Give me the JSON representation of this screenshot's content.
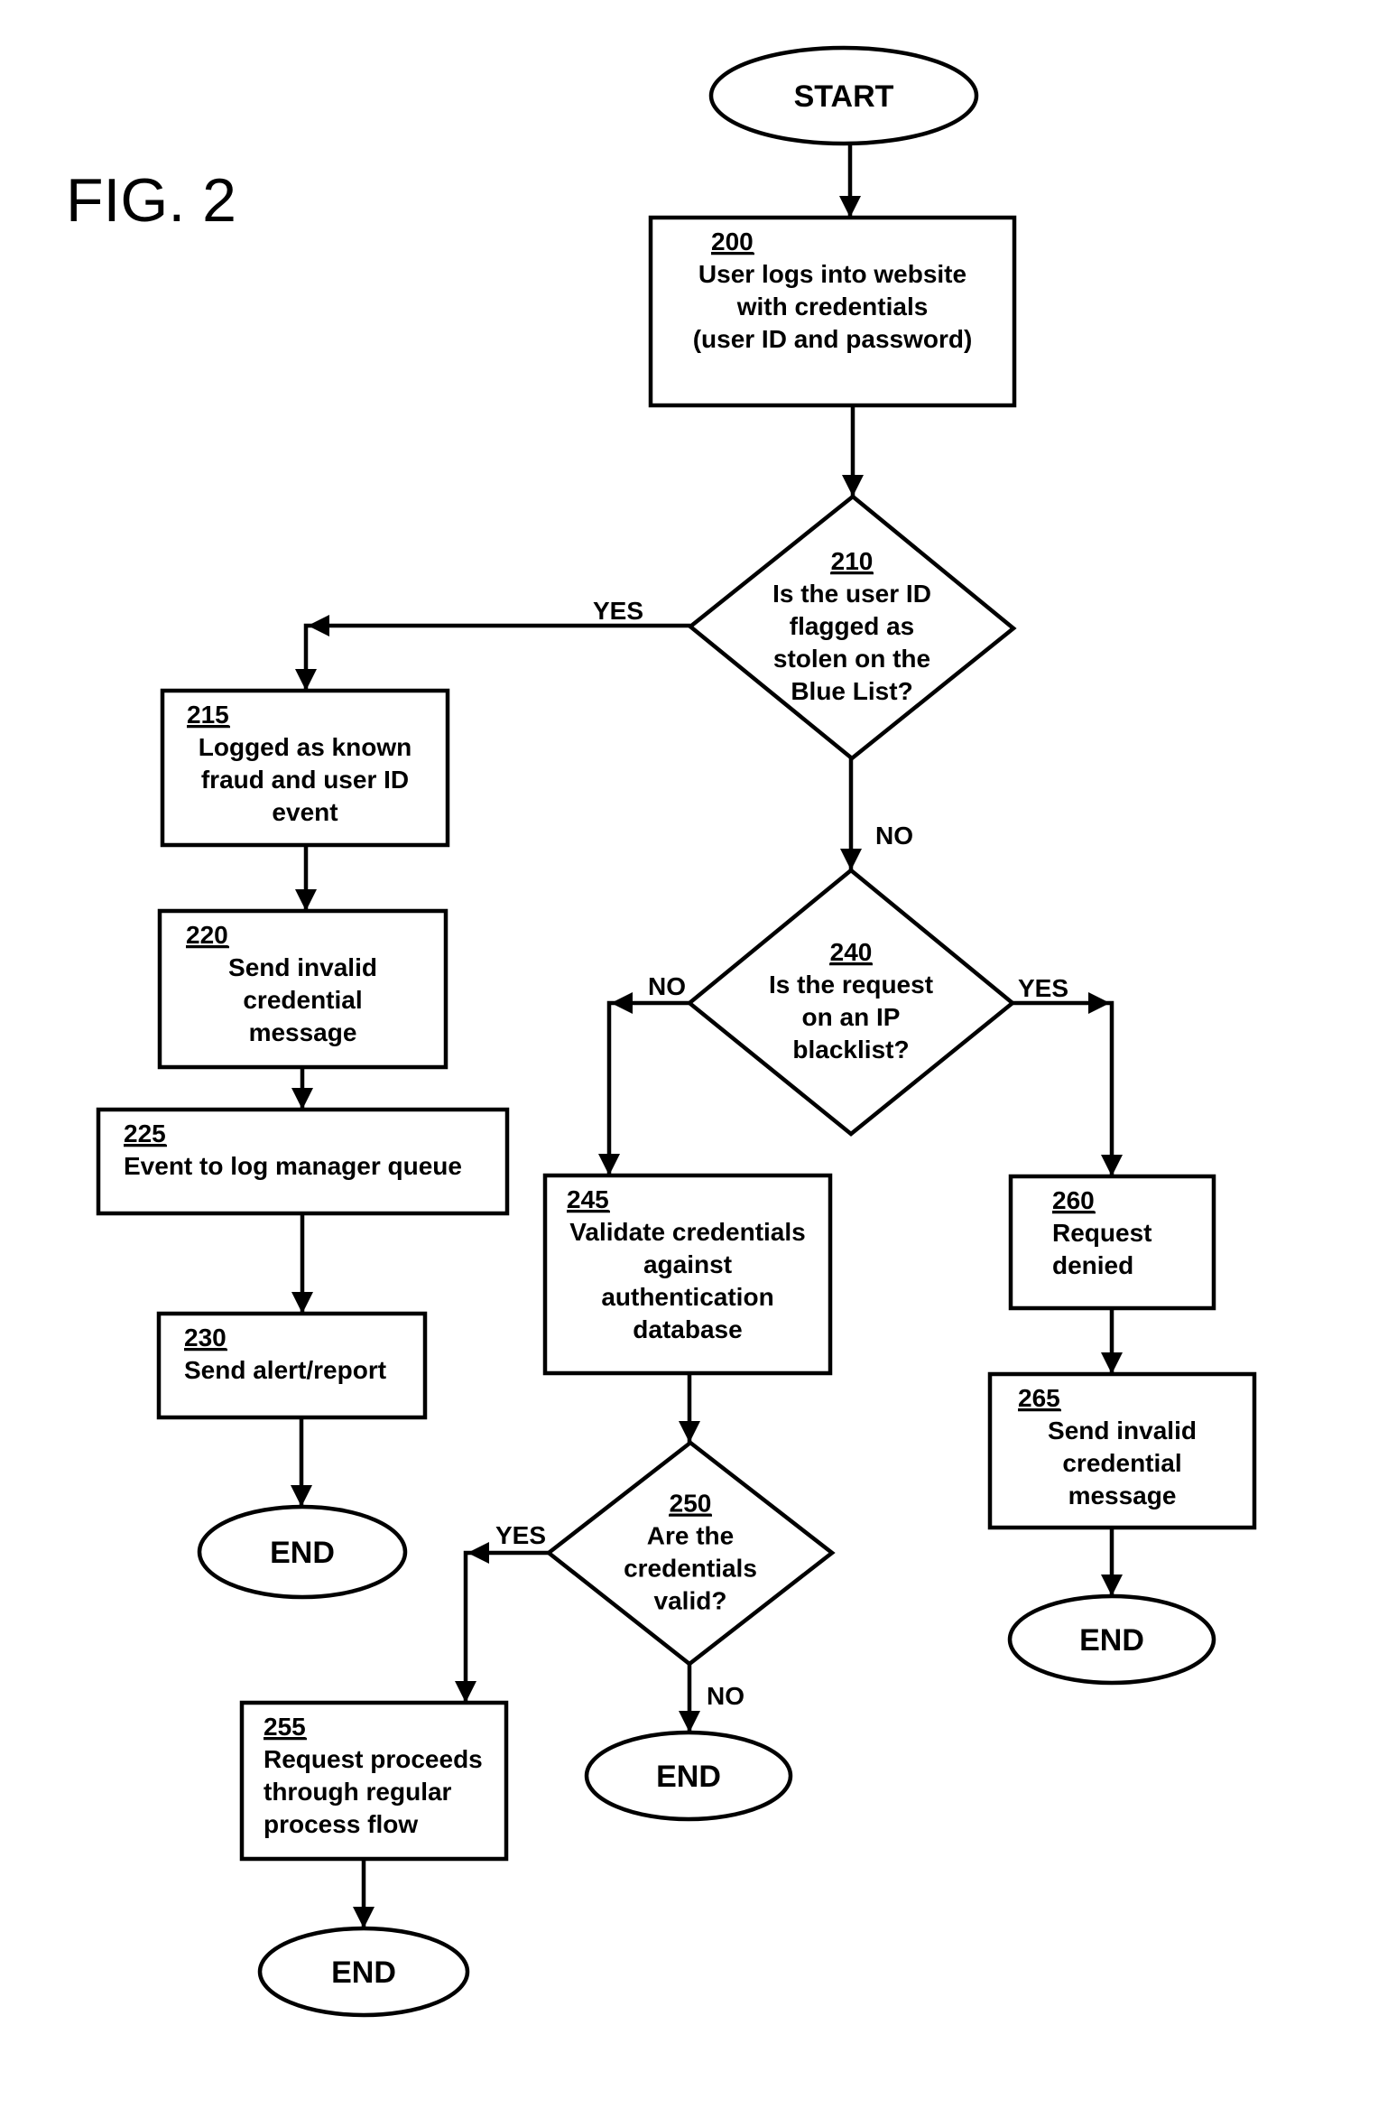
{
  "figure": {
    "title": "FIG. 2"
  },
  "nodes": {
    "start": {
      "type": "terminal",
      "label": "START"
    },
    "n200": {
      "type": "process",
      "number": "200",
      "lines": [
        "User logs into website",
        "with credentials",
        "(user ID and password)"
      ]
    },
    "n210": {
      "type": "decision",
      "number": "210",
      "lines": [
        "Is the user ID",
        "flagged as",
        "stolen on the",
        "Blue List?"
      ]
    },
    "n215": {
      "type": "process",
      "number": "215",
      "lines": [
        "Logged as known",
        "fraud and user ID",
        "event"
      ]
    },
    "n220": {
      "type": "process",
      "number": "220",
      "lines": [
        "Send invalid",
        "credential",
        "message"
      ]
    },
    "n225": {
      "type": "process",
      "number": "225",
      "lines": [
        "Event to log manager queue"
      ]
    },
    "n230": {
      "type": "process",
      "number": "230",
      "lines": [
        "Send alert/report"
      ]
    },
    "end230": {
      "type": "terminal",
      "label": "END"
    },
    "n240": {
      "type": "decision",
      "number": "240",
      "lines": [
        "Is the request",
        "on an IP",
        "blacklist?"
      ]
    },
    "n245": {
      "type": "process",
      "number": "245",
      "lines": [
        "Validate credentials",
        "against",
        "authentication",
        "database"
      ]
    },
    "n250": {
      "type": "decision",
      "number": "250",
      "lines": [
        "Are the",
        "credentials",
        "valid?"
      ]
    },
    "n255": {
      "type": "process",
      "number": "255",
      "lines": [
        "Request proceeds",
        " through regular",
        "process flow"
      ]
    },
    "end255": {
      "type": "terminal",
      "label": "END"
    },
    "end250": {
      "type": "terminal",
      "label": "END"
    },
    "n260": {
      "type": "process",
      "number": "260",
      "lines": [
        "Request",
        "denied"
      ]
    },
    "n265": {
      "type": "process",
      "number": "265",
      "lines": [
        "Send invalid",
        "credential",
        "message"
      ]
    },
    "end265": {
      "type": "terminal",
      "label": "END"
    }
  },
  "edges": [
    {
      "from": "start",
      "to": "n200",
      "label": ""
    },
    {
      "from": "n200",
      "to": "n210",
      "label": ""
    },
    {
      "from": "n210",
      "to": "n215",
      "label": "YES"
    },
    {
      "from": "n210",
      "to": "n240",
      "label": "NO"
    },
    {
      "from": "n215",
      "to": "n220",
      "label": ""
    },
    {
      "from": "n220",
      "to": "n225",
      "label": ""
    },
    {
      "from": "n225",
      "to": "n230",
      "label": ""
    },
    {
      "from": "n230",
      "to": "end230",
      "label": ""
    },
    {
      "from": "n240",
      "to": "n245",
      "label": "NO"
    },
    {
      "from": "n240",
      "to": "n260",
      "label": "YES"
    },
    {
      "from": "n245",
      "to": "n250",
      "label": ""
    },
    {
      "from": "n250",
      "to": "n255",
      "label": "YES"
    },
    {
      "from": "n250",
      "to": "end250",
      "label": "NO"
    },
    {
      "from": "n255",
      "to": "end255",
      "label": ""
    },
    {
      "from": "n260",
      "to": "n265",
      "label": ""
    },
    {
      "from": "n265",
      "to": "end265",
      "label": ""
    }
  ]
}
